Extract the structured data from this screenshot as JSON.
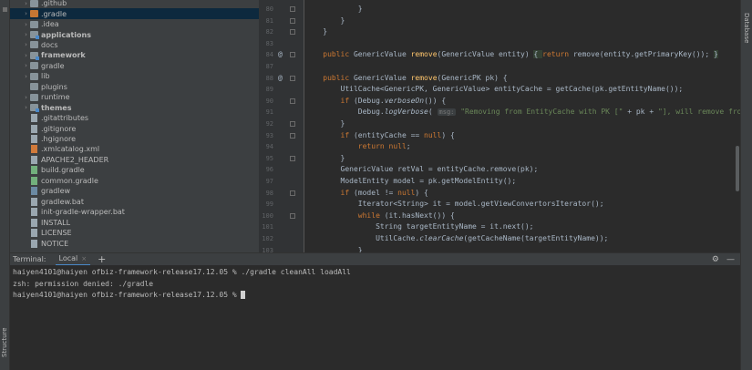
{
  "side_strips": {
    "left_label": "Structure",
    "right_label": "Database"
  },
  "project_tree": {
    "items": [
      {
        "label": ".github",
        "kind": "folder",
        "expandable": true,
        "bold": false
      },
      {
        "label": ".gradle",
        "kind": "folder-orange",
        "expandable": true,
        "bold": false,
        "selected": true
      },
      {
        "label": ".idea",
        "kind": "folder",
        "expandable": true,
        "bold": false
      },
      {
        "label": "applications",
        "kind": "module",
        "expandable": true,
        "bold": true
      },
      {
        "label": "docs",
        "kind": "folder",
        "expandable": true,
        "bold": false
      },
      {
        "label": "framework",
        "kind": "module",
        "expandable": true,
        "bold": true
      },
      {
        "label": "gradle",
        "kind": "folder",
        "expandable": true,
        "bold": false
      },
      {
        "label": "lib",
        "kind": "folder",
        "expandable": true,
        "bold": false
      },
      {
        "label": "plugins",
        "kind": "folder",
        "expandable": false,
        "bold": false
      },
      {
        "label": "runtime",
        "kind": "folder",
        "expandable": true,
        "bold": false
      },
      {
        "label": "themes",
        "kind": "module",
        "expandable": true,
        "bold": true
      },
      {
        "label": ".gitattributes",
        "kind": "file",
        "expandable": false,
        "bold": false
      },
      {
        "label": ".gitignore",
        "kind": "file",
        "expandable": false,
        "bold": false
      },
      {
        "label": ".hgignore",
        "kind": "file",
        "expandable": false,
        "bold": false
      },
      {
        "label": ".xmlcatalog.xml",
        "kind": "file-xml",
        "expandable": false,
        "bold": false
      },
      {
        "label": "APACHE2_HEADER",
        "kind": "file",
        "expandable": false,
        "bold": false
      },
      {
        "label": "build.gradle",
        "kind": "file-gradle",
        "expandable": false,
        "bold": false
      },
      {
        "label": "common.gradle",
        "kind": "file-gradle",
        "expandable": false,
        "bold": false
      },
      {
        "label": "gradlew",
        "kind": "file-term",
        "expandable": false,
        "bold": false
      },
      {
        "label": "gradlew.bat",
        "kind": "file",
        "expandable": false,
        "bold": false
      },
      {
        "label": "init-gradle-wrapper.bat",
        "kind": "file",
        "expandable": false,
        "bold": false
      },
      {
        "label": "INSTALL",
        "kind": "file",
        "expandable": false,
        "bold": false
      },
      {
        "label": "LICENSE",
        "kind": "file",
        "expandable": false,
        "bold": false
      },
      {
        "label": "NOTICE",
        "kind": "file",
        "expandable": false,
        "bold": false
      }
    ]
  },
  "editor": {
    "line_numbers": [
      "80",
      "81",
      "82",
      "83",
      "84",
      "87",
      "88",
      "89",
      "90",
      "91",
      "92",
      "93",
      "94",
      "95",
      "96",
      "97",
      "98",
      "99",
      "100",
      "101",
      "102",
      "103"
    ],
    "lines": [
      [
        {
          "t": "            }",
          "c": ""
        }
      ],
      [
        {
          "t": "        }",
          "c": ""
        }
      ],
      [
        {
          "t": "    }",
          "c": ""
        }
      ],
      [
        {
          "t": "",
          "c": ""
        }
      ],
      [
        {
          "t": "    ",
          "c": ""
        },
        {
          "t": "public ",
          "c": "kw"
        },
        {
          "t": "GenericValue ",
          "c": ""
        },
        {
          "t": "remove",
          "c": "fn"
        },
        {
          "t": "(GenericValue entity) ",
          "c": ""
        },
        {
          "t": "{ ",
          "c": "fold-hl"
        },
        {
          "t": "return ",
          "c": "kw"
        },
        {
          "t": "remove(entity.getPrimaryKey()); ",
          "c": ""
        },
        {
          "t": "}",
          "c": "fold-hl"
        }
      ],
      [
        {
          "t": "",
          "c": ""
        }
      ],
      [
        {
          "t": "    ",
          "c": ""
        },
        {
          "t": "public ",
          "c": "kw"
        },
        {
          "t": "GenericValue ",
          "c": ""
        },
        {
          "t": "remove",
          "c": "fn"
        },
        {
          "t": "(GenericPK pk) {",
          "c": ""
        }
      ],
      [
        {
          "t": "        UtilCache<GenericPK, GenericValue> entityCache = getCache(pk.getEntityName());",
          "c": ""
        }
      ],
      [
        {
          "t": "        ",
          "c": ""
        },
        {
          "t": "if ",
          "c": "kw"
        },
        {
          "t": "(Debug.",
          "c": ""
        },
        {
          "t": "verboseOn",
          "c": "it"
        },
        {
          "t": "()) {",
          "c": ""
        }
      ],
      [
        {
          "t": "            Debug.",
          "c": ""
        },
        {
          "t": "logVerbose",
          "c": "it"
        },
        {
          "t": "( ",
          "c": ""
        },
        {
          "t": "msg:",
          "c": "inl"
        },
        {
          "t": " ",
          "c": ""
        },
        {
          "t": "\"Removing from EntityCache with PK [\" ",
          "c": "str"
        },
        {
          "t": "+ pk + ",
          "c": ""
        },
        {
          "t": "\"], will remove from this ca",
          "c": "str"
        }
      ],
      [
        {
          "t": "        }",
          "c": ""
        }
      ],
      [
        {
          "t": "        ",
          "c": ""
        },
        {
          "t": "if ",
          "c": "kw"
        },
        {
          "t": "(entityCache == ",
          "c": ""
        },
        {
          "t": "null",
          "c": "kw"
        },
        {
          "t": ") {",
          "c": ""
        }
      ],
      [
        {
          "t": "            ",
          "c": ""
        },
        {
          "t": "return null",
          "c": "kw"
        },
        {
          "t": ";",
          "c": ""
        }
      ],
      [
        {
          "t": "        }",
          "c": ""
        }
      ],
      [
        {
          "t": "        GenericValue retVal = entityCache.remove(pk);",
          "c": ""
        }
      ],
      [
        {
          "t": "        ModelEntity model = pk.getModelEntity();",
          "c": ""
        }
      ],
      [
        {
          "t": "        ",
          "c": ""
        },
        {
          "t": "if ",
          "c": "kw"
        },
        {
          "t": "(model != ",
          "c": ""
        },
        {
          "t": "null",
          "c": "kw"
        },
        {
          "t": ") {",
          "c": ""
        }
      ],
      [
        {
          "t": "            Iterator<String> it = model.getViewConvertorsIterator();",
          "c": ""
        }
      ],
      [
        {
          "t": "            ",
          "c": ""
        },
        {
          "t": "while ",
          "c": "kw"
        },
        {
          "t": "(it.hasNext()) {",
          "c": ""
        }
      ],
      [
        {
          "t": "                String targetEntityName = it.next();",
          "c": ""
        }
      ],
      [
        {
          "t": "                UtilCache.",
          "c": ""
        },
        {
          "t": "clearCache",
          "c": "it"
        },
        {
          "t": "(getCacheName(targetEntityName));",
          "c": ""
        }
      ],
      [
        {
          "t": "            }",
          "c": ""
        }
      ]
    ]
  },
  "terminal": {
    "title": "Terminal:",
    "tab_label": "Local",
    "tab_close": "×",
    "new_tab": "+",
    "settings_icon": "gear-icon",
    "hide_icon": "minimize-icon",
    "lines": [
      "haiyen4101@haiyen ofbiz-framework-release17.12.05 % ./gradle cleanAll loadAll",
      "zsh: permission denied: ./gradle",
      "haiyen4101@haiyen ofbiz-framework-release17.12.05 % "
    ]
  }
}
